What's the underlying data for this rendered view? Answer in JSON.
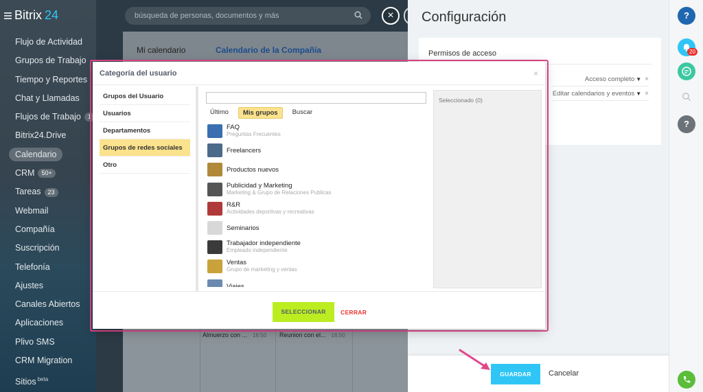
{
  "app": {
    "logo_text": "Bitrix",
    "logo_accent": "24"
  },
  "sidebar": {
    "items": [
      {
        "label": "Flujo de Actividad"
      },
      {
        "label": "Grupos de Trabajo"
      },
      {
        "label": "Tiempo y Reportes"
      },
      {
        "label": "Chat y Llamadas"
      },
      {
        "label": "Flujos de Trabajo",
        "badge": "1"
      },
      {
        "label": "Bitrix24.Drive"
      },
      {
        "label": "Calendario",
        "active": true
      },
      {
        "label": "CRM",
        "badge": "50+"
      },
      {
        "label": "Tareas",
        "badge": "23"
      },
      {
        "label": "Webmail"
      },
      {
        "label": "Compañía"
      },
      {
        "label": "Suscripción"
      },
      {
        "label": "Telefonía"
      },
      {
        "label": "Ajustes"
      },
      {
        "label": "Canales Abiertos"
      },
      {
        "label": "Aplicaciones"
      },
      {
        "label": "Plivo SMS"
      },
      {
        "label": "CRM Migration"
      },
      {
        "label": "Sitios",
        "sup": "beta"
      }
    ]
  },
  "search": {
    "placeholder": "búsqueda de personas, documentos y más"
  },
  "calendar": {
    "tabs": [
      "Mi calendario",
      "Calendario de la Compañía"
    ],
    "events": [
      {
        "title": "Almuerzo con ...",
        "time": "16:50"
      },
      {
        "title": "Reunion con el...",
        "time": "16:50"
      }
    ]
  },
  "config": {
    "title": "Configuración",
    "section_title": "Permisos de acceso",
    "permissions": [
      {
        "value": "Acceso completo"
      },
      {
        "value": "Editar calendarios y eventos"
      }
    ],
    "save_label": "GUARDAR",
    "cancel_label": "Cancelar"
  },
  "rail": {
    "help_label": "?",
    "notifications_badge": "20",
    "avatar_label": "?"
  },
  "modal": {
    "title": "Categoría del usuario",
    "categories": [
      {
        "label": "Grupos del Usuario"
      },
      {
        "label": "Usuarios"
      },
      {
        "label": "Departamentos"
      },
      {
        "label": "Grupos de redes sociales",
        "active": true
      },
      {
        "label": "Otro"
      }
    ],
    "search_value": "",
    "tabs": [
      {
        "label": "Último"
      },
      {
        "label": "Mis grupos",
        "active": true
      },
      {
        "label": "Buscar"
      }
    ],
    "groups": [
      {
        "name": "FAQ",
        "subtitle": "Preguntas Frecuentes",
        "thumb_color": "#3a6fb0"
      },
      {
        "name": "Freelancers",
        "subtitle": "",
        "thumb_color": "#4c6a8a"
      },
      {
        "name": "Productos nuevos",
        "subtitle": "",
        "thumb_color": "#b08a3a"
      },
      {
        "name": "Publicidad y Marketing",
        "subtitle": "Marketing & Grupo de Relaciones Publicas",
        "thumb_color": "#555"
      },
      {
        "name": "R&R",
        "subtitle": "Actividades deportivas y recreativas",
        "thumb_color": "#b03a3a"
      },
      {
        "name": "Seminarios",
        "subtitle": "",
        "thumb_color": "#d8d8d8"
      },
      {
        "name": "Trabajador independiente",
        "subtitle": "Empleado independiente",
        "thumb_color": "#3a3a3a"
      },
      {
        "name": "Ventas",
        "subtitle": "Grupo de marketing y ventas",
        "thumb_color": "#c9a23a"
      },
      {
        "name": "Viajes",
        "subtitle": "",
        "thumb_color": "#6a8ab0"
      }
    ],
    "selected_label": "Seleccionado (0)",
    "select_label": "SELECCIONAR",
    "close_label": "CERRAR"
  }
}
